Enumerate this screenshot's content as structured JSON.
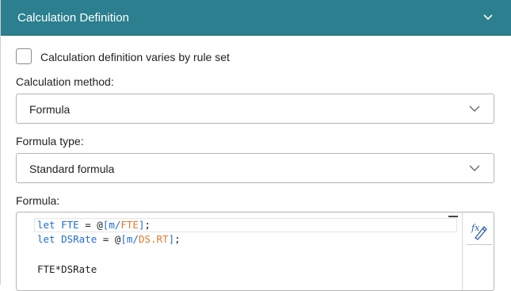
{
  "header": {
    "title": "Calculation Definition",
    "chevron_icon": "chevron-down-icon"
  },
  "varies_checkbox": {
    "label": "Calculation definition varies by rule set",
    "checked": false
  },
  "calculation_method": {
    "label": "Calculation method:",
    "value": "Formula"
  },
  "formula_type": {
    "label": "Formula type:",
    "value": "Standard formula"
  },
  "formula": {
    "label": "Formula:",
    "lines": [
      [
        {
          "t": "let",
          "k": "kw"
        },
        {
          "t": " ",
          "k": "plain"
        },
        {
          "t": "FTE",
          "k": "kw"
        },
        {
          "t": " = @",
          "k": "plain"
        },
        {
          "t": "[m/",
          "k": "br"
        },
        {
          "t": "FTE",
          "k": "ref"
        },
        {
          "t": "]",
          "k": "br"
        },
        {
          "t": ";",
          "k": "plain"
        }
      ],
      [
        {
          "t": "let",
          "k": "kw"
        },
        {
          "t": " ",
          "k": "plain"
        },
        {
          "t": "DSRate",
          "k": "kw"
        },
        {
          "t": " = @",
          "k": "plain"
        },
        {
          "t": "[m/",
          "k": "br"
        },
        {
          "t": "DS.RT",
          "k": "ref"
        },
        {
          "t": "]",
          "k": "br"
        },
        {
          "t": ";",
          "k": "plain"
        }
      ],
      [],
      [
        {
          "t": "FTE*DSRate",
          "k": "plain"
        }
      ]
    ],
    "fx_icon": "function-editor-icon"
  },
  "colors": {
    "header_bg": "#2b7f8e",
    "keyword": "#1f6fd1",
    "reference": "#e07b2a"
  }
}
